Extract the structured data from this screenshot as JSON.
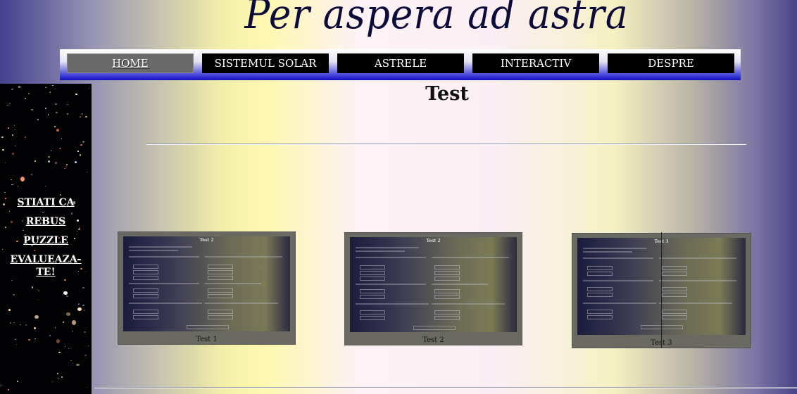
{
  "site": {
    "title": "Per aspera ad astra"
  },
  "nav": {
    "items": [
      {
        "label": "HOME",
        "active": true
      },
      {
        "label": "SISTEMUL SOLAR",
        "active": false
      },
      {
        "label": "ASTRELE",
        "active": false
      },
      {
        "label": "INTERACTIV",
        "active": false
      },
      {
        "label": "DESPRE",
        "active": false
      }
    ]
  },
  "sidebar": {
    "links": [
      {
        "label": "STIATI CA"
      },
      {
        "label": "REBUS"
      },
      {
        "label": "PUZZLE"
      },
      {
        "label": "EVALUEAZA-TE!"
      }
    ]
  },
  "main": {
    "heading": "Test",
    "thumbnails": [
      {
        "caption": "Test 1",
        "inner_title": "Test 2"
      },
      {
        "caption": "Test 2",
        "inner_title": "Test 2"
      },
      {
        "caption": "Test 3",
        "inner_title": "Test 3"
      }
    ]
  },
  "colors": {
    "nav_bg": "#000000",
    "nav_active_bg": "#6a6a6a",
    "nav_bar_accent": "#1010c0",
    "title_color": "#0c0b3a"
  }
}
